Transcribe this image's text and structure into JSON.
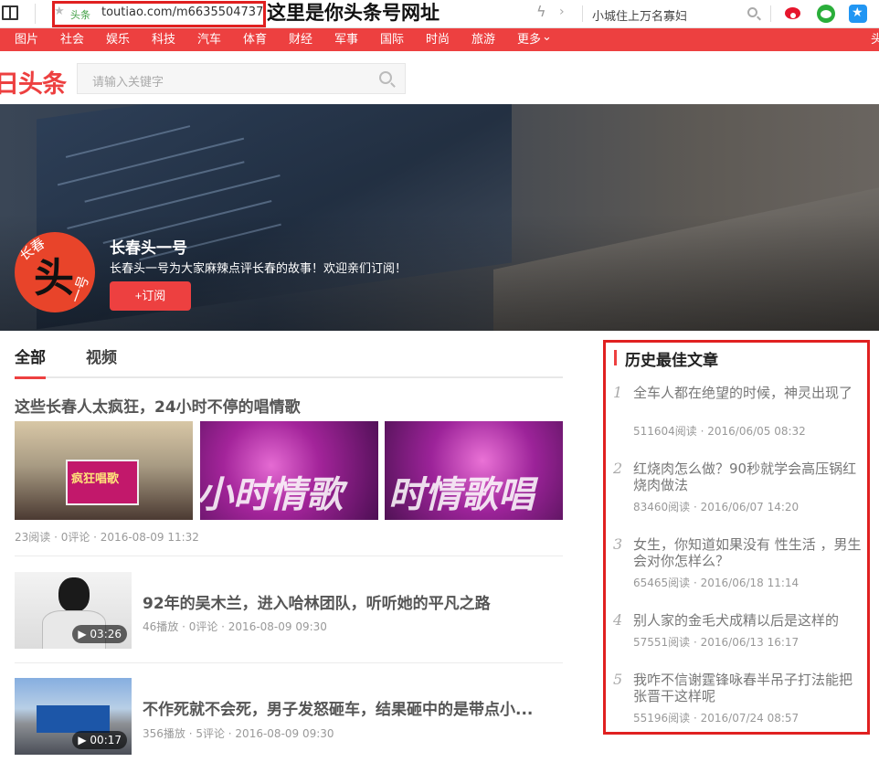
{
  "browser": {
    "site_tag": "头条",
    "url": "toutiao.com/m6635504737",
    "annotation": "这里是你头条号网址",
    "hot_query": "小城住上万名寡妇"
  },
  "nav": {
    "items": [
      "图片",
      "社会",
      "娱乐",
      "科技",
      "汽车",
      "体育",
      "财经",
      "军事",
      "国际",
      "时尚",
      "旅游",
      "更多"
    ],
    "more_arrow": "⌄",
    "right_edge": "头"
  },
  "header": {
    "logo": "日头条",
    "search_placeholder": "请输入关键字"
  },
  "profile": {
    "avatar_text": {
      "big": "头",
      "top": "长春",
      "bottom": "一号"
    },
    "name": "长春头一号",
    "description": "长春头一号为大家麻辣点评长春的故事！欢迎亲们订阅！",
    "subscribe_label": "+订阅"
  },
  "tabs": [
    "全部",
    "视频"
  ],
  "articles": [
    {
      "title": "这些长春人太疯狂，24小时不停的唱情歌",
      "meta": "23阅读 · 0评论 · 2016-08-09 11:32",
      "thumb_texts": [
        "疯狂唱歌",
        "小时情歌唱",
        "时情歌唱"
      ]
    },
    {
      "title": "92年的吴木兰，进入哈林团队，听听她的平凡之路",
      "meta": "46播放 · 0评论 · 2016-08-09 09:30",
      "duration": "▶ 03:26"
    },
    {
      "title": "不作死就不会死，男子发怒砸车，结果砸中的是带点小...",
      "meta": "356播放 · 5评论 · 2016-08-09 09:30",
      "duration": "▶ 00:17"
    }
  ],
  "sidebar": {
    "title": "历史最佳文章",
    "items": [
      {
        "num": "1",
        "title": "全车人都在绝望的时候，神灵出现了",
        "meta": "511604阅读 · 2016/06/05 08:32"
      },
      {
        "num": "2",
        "title": "红烧肉怎么做？90秒就学会高压锅红烧肉做法",
        "meta": "83460阅读 · 2016/06/07 14:20"
      },
      {
        "num": "3",
        "title": "女生，你知道如果没有 性生活 ，男生会对你怎样么？",
        "meta": "65465阅读 · 2016/06/18 11:14"
      },
      {
        "num": "4",
        "title": "别人家的金毛犬成精以后是这样的",
        "meta": "57551阅读 · 2016/06/13 16:17"
      },
      {
        "num": "5",
        "title": "我咋不信谢霆锋咏春半吊子打法能把张晋干这样呢",
        "meta": "55196阅读 · 2016/07/24 08:57"
      }
    ]
  }
}
